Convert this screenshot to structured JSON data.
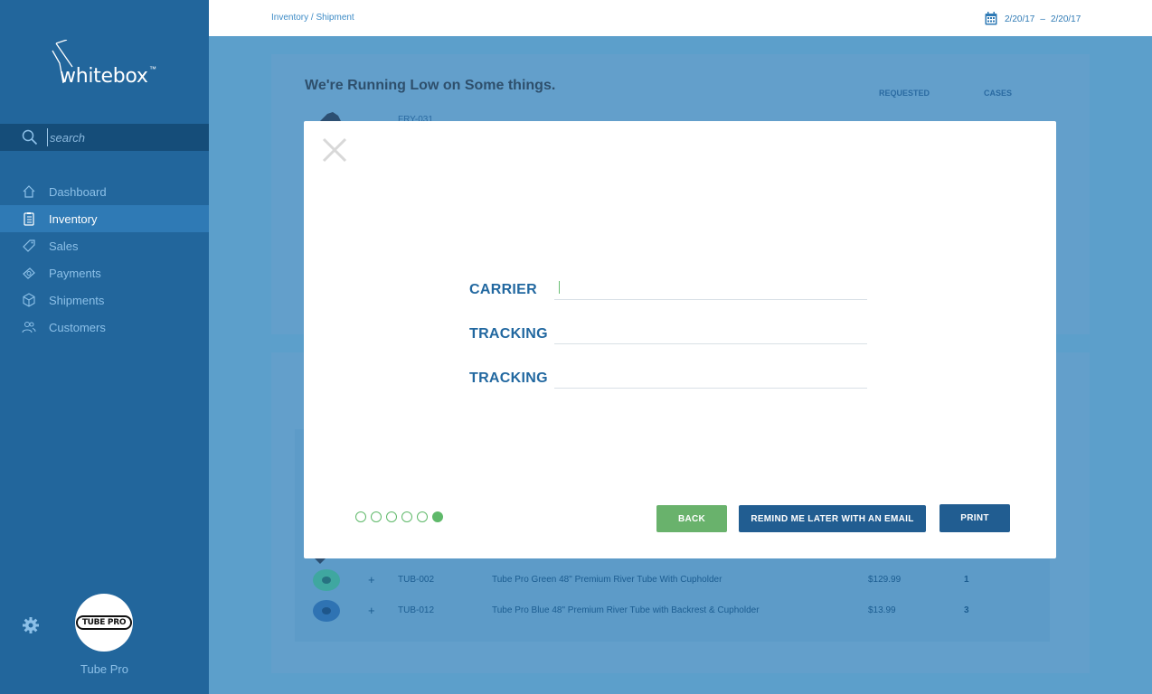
{
  "sidebar": {
    "logo": "whitebox",
    "logo_tm": "™",
    "search_placeholder": "search",
    "nav": [
      {
        "label": "Dashboard",
        "icon": "home-icon"
      },
      {
        "label": "Inventory",
        "icon": "clipboard-icon",
        "active": true
      },
      {
        "label": "Sales",
        "icon": "tag-icon"
      },
      {
        "label": "Payments",
        "icon": "money-icon"
      },
      {
        "label": "Shipments",
        "icon": "box-icon"
      },
      {
        "label": "Customers",
        "icon": "users-icon"
      }
    ],
    "brand_logo": "TUBE PRO",
    "brand_name": "Tube Pro"
  },
  "topbar": {
    "breadcrumb": "Inventory / Shipment",
    "date_from": "2/20/17",
    "date_sep": "–",
    "date_to": "2/20/17"
  },
  "background": {
    "title": "We're Running Low on Some things.",
    "col_requested": "REQUESTED",
    "col_cases": "CASES",
    "top_sku": "FRY-031",
    "rows": [
      {
        "sku": "TUB-002",
        "desc": "Tube Pro Green 48\" Premium River Tube With Cupholder",
        "price": "$129.99",
        "qty": "1",
        "color": "#3fa7a0"
      },
      {
        "sku": "TUB-012",
        "desc": "Tube Pro Blue 48\" Premium River Tube with Backrest & Cupholder",
        "price": "$13.99",
        "qty": "3",
        "color": "#2f73b3"
      }
    ]
  },
  "modal": {
    "fields": [
      {
        "label": "CARRIER",
        "value": ""
      },
      {
        "label": "TRACKING",
        "value": ""
      },
      {
        "label": "TRACKING",
        "value": ""
      }
    ],
    "steps_total": 6,
    "step_active": 6,
    "back_label": "BACK",
    "remind_label": "REMIND ME LATER WITH AN EMAIL",
    "print_label": "PRINT"
  },
  "colors": {
    "sidebar": "#22669c",
    "accent": "#2268a0",
    "success": "#5fb96a"
  }
}
